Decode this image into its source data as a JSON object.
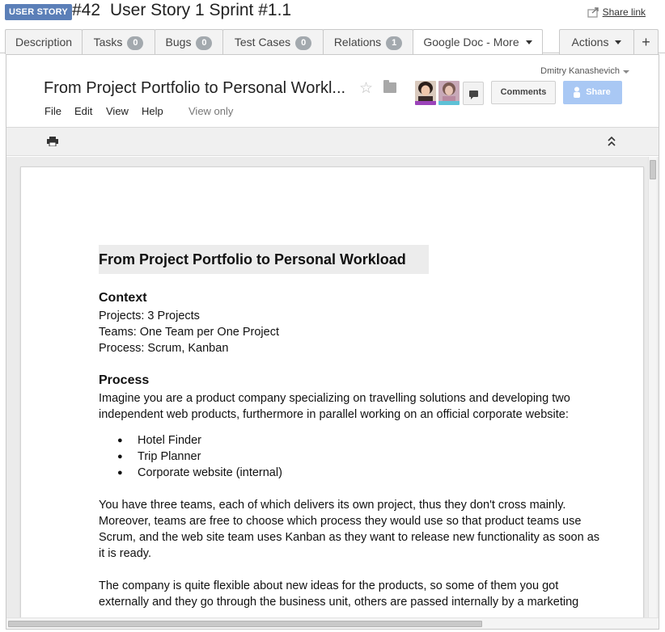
{
  "header": {
    "badge": "USER STORY",
    "number": "#42",
    "title": "User Story 1 Sprint #1.1",
    "share_link": "Share link"
  },
  "tabs": [
    {
      "label": "Description"
    },
    {
      "label": "Tasks",
      "count": "0"
    },
    {
      "label": "Bugs",
      "count": "0"
    },
    {
      "label": "Test Cases",
      "count": "0"
    },
    {
      "label": "Relations",
      "count": "1"
    },
    {
      "label": "Google Doc - More"
    },
    {
      "label": "Actions"
    },
    {
      "label": "+"
    }
  ],
  "gdoc": {
    "user_name": "Dmitry Kanashevich",
    "title": "From Project Portfolio to Personal Workl...",
    "menu": [
      "File",
      "Edit",
      "View",
      "Help"
    ],
    "view_only": "View only",
    "comments_label": "Comments",
    "share_label": "Share",
    "colors": {
      "share_bg": "#a9c8f4",
      "avatar1_bar": "#9b43b9",
      "avatar2_bar": "#5ec1d6"
    }
  },
  "document": {
    "heading": "From Project Portfolio to Personal Workload",
    "context_heading": "Context",
    "context_lines": [
      "Projects: 3 Projects",
      "Teams: One Team per One Project",
      "Process: Scrum, Kanban"
    ],
    "process_heading": "Process",
    "process_intro": "Imagine you are a product company specializing on travelling solutions and developing two independent web products, furthermore in parallel working on an official corporate website:",
    "bullets": [
      "Hotel Finder",
      "Trip Planner",
      "Corporate website (internal)"
    ],
    "paragraph2": "You have three teams, each of which delivers its own project, thus they don't cross mainly. Moreover, teams are free to choose which process they would use so that product teams use Scrum, and the web site team uses Kanban as they want to release new functionality as soon as it is ready.",
    "paragraph3": "The company is quite flexible about new ideas for the products, so some of them you got externally and they go through the business unit, others are passed internally by a marketing"
  }
}
